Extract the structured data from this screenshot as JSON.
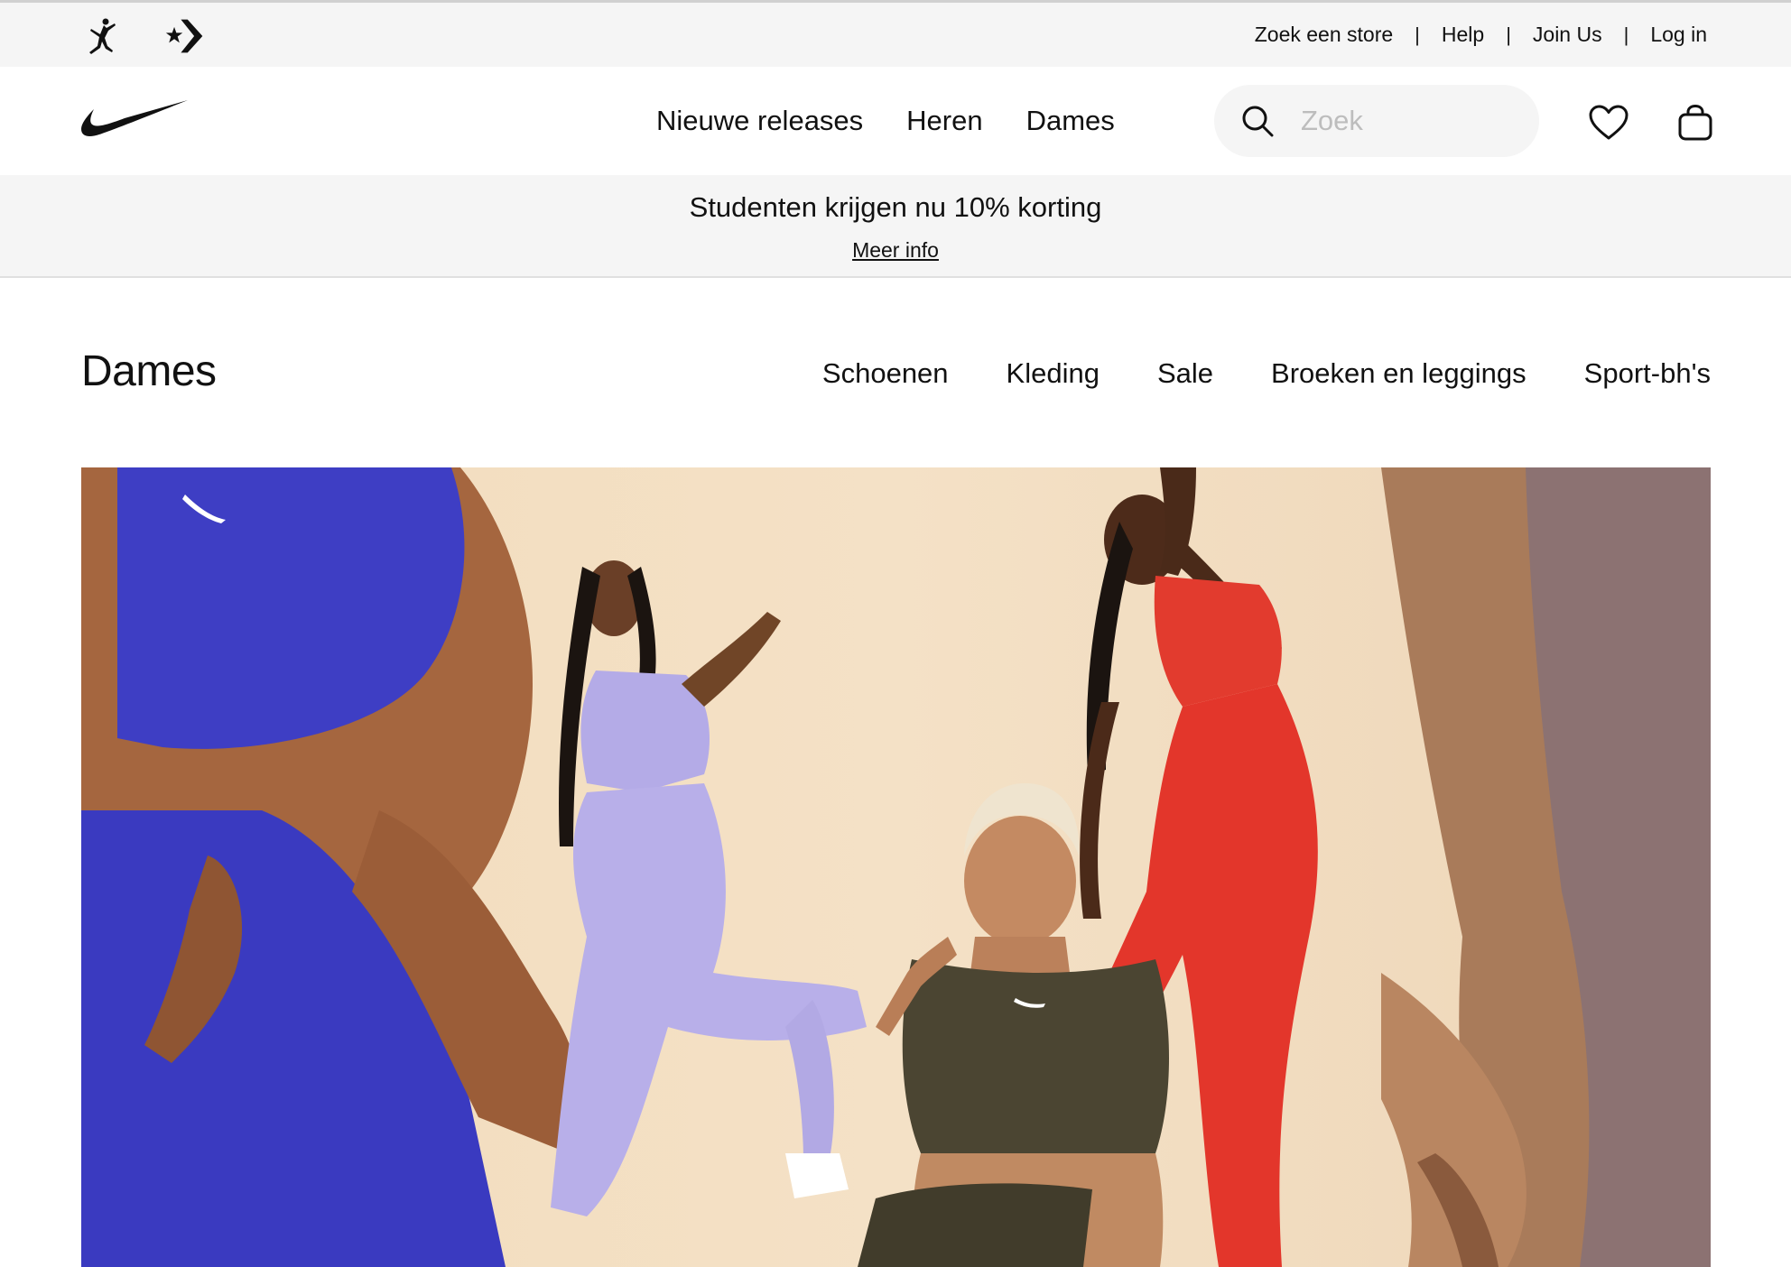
{
  "utility_bar": {
    "links": [
      "Zoek een store",
      "Help",
      "Join Us",
      "Log in"
    ],
    "separator": "|"
  },
  "icons": {
    "jordan": "jordan-jumpman-icon",
    "converse": "converse-star-chevron-icon",
    "nike": "nike-swoosh-logo",
    "search": "search-icon",
    "favorites": "heart-icon",
    "bag": "shopping-bag-icon"
  },
  "main_nav": {
    "items": [
      "Nieuwe releases",
      "Heren",
      "Dames"
    ]
  },
  "search": {
    "placeholder": "Zoek"
  },
  "promo": {
    "title": "Studenten krijgen nu 10% korting",
    "link": "Meer info"
  },
  "section": {
    "title": "Dames",
    "categories": [
      "Schoenen",
      "Kleding",
      "Sale",
      "Broeken en leggings",
      "Sport-bh's"
    ]
  },
  "colors": {
    "bar_bg": "#f5f5f5",
    "text": "#111111",
    "hero_bg": "#f1ddc0",
    "blue_outfit": "#3d3fc6",
    "lavender_outfit": "#b6aee9",
    "olive_outfit": "#4b4532",
    "red_outfit": "#e6332a"
  }
}
